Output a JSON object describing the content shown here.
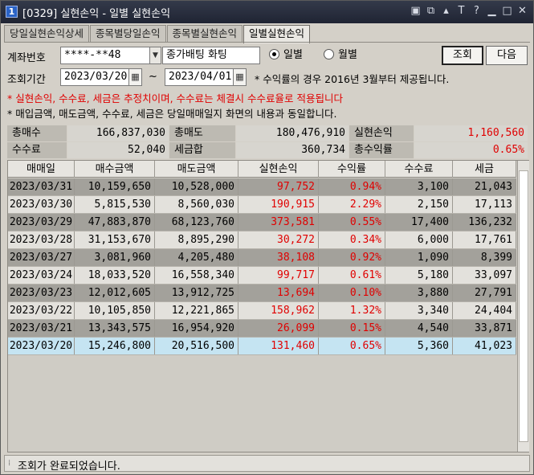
{
  "window": {
    "number": "1",
    "title": "[0329] 실현손익 - 일별 실현손익",
    "icons": [
      "restore-icon",
      "tile-icon",
      "pin-icon",
      "font-icon",
      "help-icon",
      "minimize-icon",
      "maximize-icon",
      "close-icon"
    ]
  },
  "tabs": [
    {
      "label": "당일실현손익상세",
      "active": false
    },
    {
      "label": "종목별당일손익",
      "active": false
    },
    {
      "label": "종목별실현손익",
      "active": false
    },
    {
      "label": "일별실현손익",
      "active": true
    }
  ],
  "form": {
    "account_label": "계좌번호",
    "account_value": "****-**48",
    "account_name": "종가배팅 화팅",
    "radio_daily": "일별",
    "radio_monthly": "월별",
    "selected": "daily",
    "search_button": "조회",
    "next_button": "다음",
    "period_label": "조회기간",
    "date_from": "2023/03/20",
    "date_to": "2023/04/01",
    "tilde": "~",
    "period_note": "* 수익률의 경우 2016년 3월부터 제공됩니다."
  },
  "notices": [
    {
      "text": "* 실현손익, 수수료, 세금은 추정치이며, 수수료는 체결시 수수료율로 적용됩니다",
      "color": "#e00000"
    },
    {
      "text": "* 매입금액, 매도금액, 수수료, 세금은 당일매매일지 화면의 내용과 동일합니다.",
      "color": "#000000"
    }
  ],
  "summary": {
    "total_buy_label": "총매수",
    "total_buy": "166,837,030",
    "total_sell_label": "총매도",
    "total_sell": "180,476,910",
    "realized_label": "실현손익",
    "realized": "1,160,560",
    "fee_label": "수수료",
    "fee": "52,040",
    "tax_label": "세금합",
    "tax": "360,734",
    "return_label": "총수익률",
    "return": "0.65%"
  },
  "table": {
    "columns": [
      "매매일",
      "매수금액",
      "매도금액",
      "실현손익",
      "수익률",
      "수수료",
      "세금"
    ],
    "rows": [
      {
        "date": "2023/03/31",
        "buy": "10,159,650",
        "sell": "10,528,000",
        "pnl": "97,752",
        "rate": "0.94%",
        "fee": "3,100",
        "tax": "21,043"
      },
      {
        "date": "2023/03/30",
        "buy": "5,815,530",
        "sell": "8,560,030",
        "pnl": "190,915",
        "rate": "2.29%",
        "fee": "2,150",
        "tax": "17,113"
      },
      {
        "date": "2023/03/29",
        "buy": "47,883,870",
        "sell": "68,123,760",
        "pnl": "373,581",
        "rate": "0.55%",
        "fee": "17,400",
        "tax": "136,232"
      },
      {
        "date": "2023/03/28",
        "buy": "31,153,670",
        "sell": "8,895,290",
        "pnl": "30,272",
        "rate": "0.34%",
        "fee": "6,000",
        "tax": "17,761"
      },
      {
        "date": "2023/03/27",
        "buy": "3,081,960",
        "sell": "4,205,480",
        "pnl": "38,108",
        "rate": "0.92%",
        "fee": "1,090",
        "tax": "8,399"
      },
      {
        "date": "2023/03/24",
        "buy": "18,033,520",
        "sell": "16,558,340",
        "pnl": "99,717",
        "rate": "0.61%",
        "fee": "5,180",
        "tax": "33,097"
      },
      {
        "date": "2023/03/23",
        "buy": "12,012,605",
        "sell": "13,912,725",
        "pnl": "13,694",
        "rate": "0.10%",
        "fee": "3,880",
        "tax": "27,791"
      },
      {
        "date": "2023/03/22",
        "buy": "10,105,850",
        "sell": "12,221,865",
        "pnl": "158,962",
        "rate": "1.32%",
        "fee": "3,340",
        "tax": "24,404"
      },
      {
        "date": "2023/03/21",
        "buy": "13,343,575",
        "sell": "16,954,920",
        "pnl": "26,099",
        "rate": "0.15%",
        "fee": "4,540",
        "tax": "33,871"
      },
      {
        "date": "2023/03/20",
        "buy": "15,246,800",
        "sell": "20,516,500",
        "pnl": "131,460",
        "rate": "0.65%",
        "fee": "5,360",
        "tax": "41,023"
      }
    ]
  },
  "status": {
    "message": "조회가 완료되었습니다."
  },
  "colors": {
    "positive": "#e00000",
    "selected_row": "#c5e4f2",
    "title_bar": "#262b3a"
  }
}
